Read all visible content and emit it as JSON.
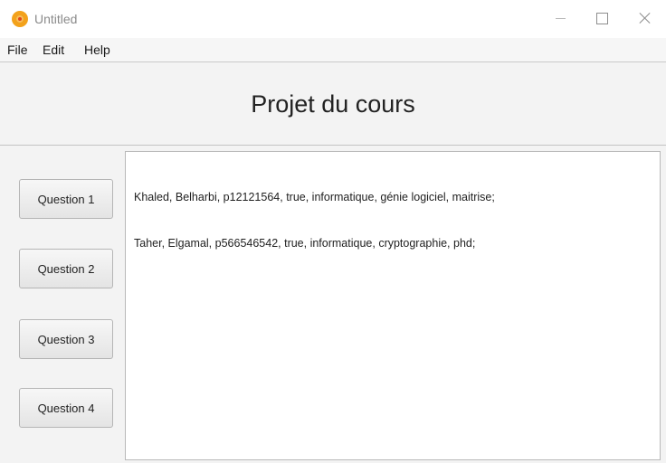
{
  "window": {
    "title": "Untitled"
  },
  "menu": {
    "items": [
      "File",
      "Edit",
      "Help"
    ]
  },
  "header": {
    "title": "Projet du cours"
  },
  "sidebar": {
    "buttons": [
      "Question 1",
      "Question 2",
      "Question 3",
      "Question 4"
    ]
  },
  "output": {
    "lines": [
      "Khaled, Belharbi, p12121564, true, informatique, génie logiciel, maitrise;",
      "Taher, Elgamal, p566546542, true, informatique, cryptographie, phd;"
    ]
  },
  "colors": {
    "app_icon": "#f3a21b",
    "window_bg": "#f3f3f3"
  }
}
